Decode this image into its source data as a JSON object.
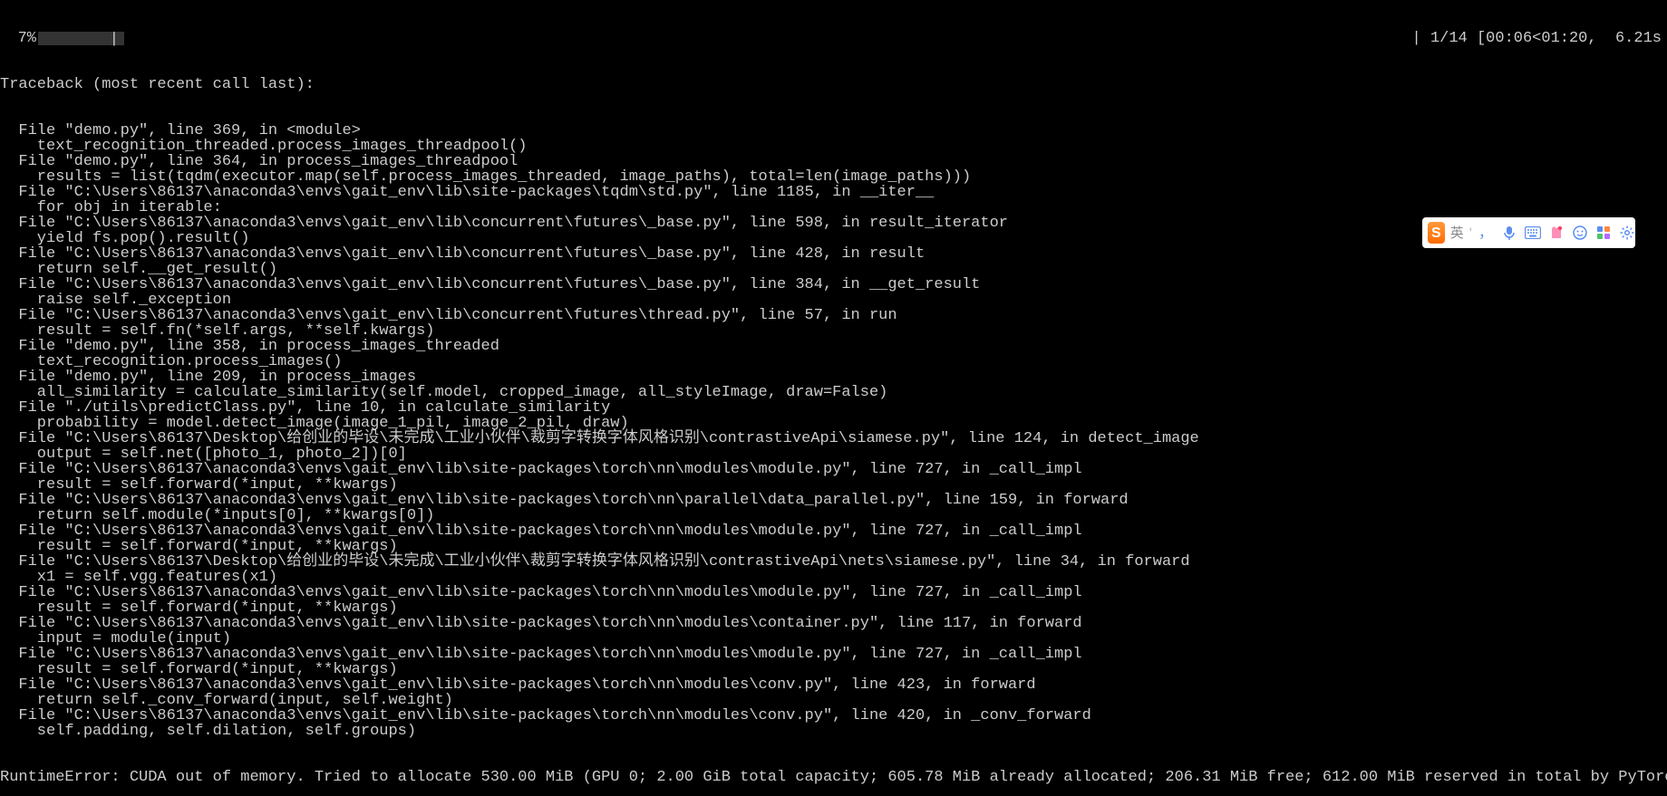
{
  "progress": {
    "percent_label": "7%",
    "fill_percent": 7,
    "stats": "| 1/14 [00:06<01:20,  6.21s"
  },
  "traceback": {
    "header": "Traceback (most recent call last):",
    "frames": [
      {
        "loc": "  File \"demo.py\", line 369, in <module>",
        "code": "    text_recognition_threaded.process_images_threadpool()"
      },
      {
        "loc": "  File \"demo.py\", line 364, in process_images_threadpool",
        "code": "    results = list(tqdm(executor.map(self.process_images_threaded, image_paths), total=len(image_paths)))"
      },
      {
        "loc": "  File \"C:\\Users\\86137\\anaconda3\\envs\\gait_env\\lib\\site-packages\\tqdm\\std.py\", line 1185, in __iter__",
        "code": "    for obj in iterable:"
      },
      {
        "loc": "  File \"C:\\Users\\86137\\anaconda3\\envs\\gait_env\\lib\\concurrent\\futures\\_base.py\", line 598, in result_iterator",
        "code": "    yield fs.pop().result()"
      },
      {
        "loc": "  File \"C:\\Users\\86137\\anaconda3\\envs\\gait_env\\lib\\concurrent\\futures\\_base.py\", line 428, in result",
        "code": "    return self.__get_result()"
      },
      {
        "loc": "  File \"C:\\Users\\86137\\anaconda3\\envs\\gait_env\\lib\\concurrent\\futures\\_base.py\", line 384, in __get_result",
        "code": "    raise self._exception"
      },
      {
        "loc": "  File \"C:\\Users\\86137\\anaconda3\\envs\\gait_env\\lib\\concurrent\\futures\\thread.py\", line 57, in run",
        "code": "    result = self.fn(*self.args, **self.kwargs)"
      },
      {
        "loc": "  File \"demo.py\", line 358, in process_images_threaded",
        "code": "    text_recognition.process_images()"
      },
      {
        "loc": "  File \"demo.py\", line 209, in process_images",
        "code": "    all_similarity = calculate_similarity(self.model, cropped_image, all_styleImage, draw=False)"
      },
      {
        "loc": "  File \"./utils\\predictClass.py\", line 10, in calculate_similarity",
        "code": "    probability = model.detect_image(image_1_pil, image_2_pil, draw)"
      },
      {
        "loc": "  File \"C:\\Users\\86137\\Desktop\\给创业的毕设\\未完成\\工业小伙伴\\裁剪字转换字体风格识别\\contrastiveApi\\siamese.py\", line 124, in detect_image",
        "code": "    output = self.net([photo_1, photo_2])[0]"
      },
      {
        "loc": "  File \"C:\\Users\\86137\\anaconda3\\envs\\gait_env\\lib\\site-packages\\torch\\nn\\modules\\module.py\", line 727, in _call_impl",
        "code": "    result = self.forward(*input, **kwargs)"
      },
      {
        "loc": "  File \"C:\\Users\\86137\\anaconda3\\envs\\gait_env\\lib\\site-packages\\torch\\nn\\parallel\\data_parallel.py\", line 159, in forward",
        "code": "    return self.module(*inputs[0], **kwargs[0])"
      },
      {
        "loc": "  File \"C:\\Users\\86137\\anaconda3\\envs\\gait_env\\lib\\site-packages\\torch\\nn\\modules\\module.py\", line 727, in _call_impl",
        "code": "    result = self.forward(*input, **kwargs)"
      },
      {
        "loc": "  File \"C:\\Users\\86137\\Desktop\\给创业的毕设\\未完成\\工业小伙伴\\裁剪字转换字体风格识别\\contrastiveApi\\nets\\siamese.py\", line 34, in forward",
        "code": "    x1 = self.vgg.features(x1)"
      },
      {
        "loc": "  File \"C:\\Users\\86137\\anaconda3\\envs\\gait_env\\lib\\site-packages\\torch\\nn\\modules\\module.py\", line 727, in _call_impl",
        "code": "    result = self.forward(*input, **kwargs)"
      },
      {
        "loc": "  File \"C:\\Users\\86137\\anaconda3\\envs\\gait_env\\lib\\site-packages\\torch\\nn\\modules\\container.py\", line 117, in forward",
        "code": "    input = module(input)"
      },
      {
        "loc": "  File \"C:\\Users\\86137\\anaconda3\\envs\\gait_env\\lib\\site-packages\\torch\\nn\\modules\\module.py\", line 727, in _call_impl",
        "code": "    result = self.forward(*input, **kwargs)"
      },
      {
        "loc": "  File \"C:\\Users\\86137\\anaconda3\\envs\\gait_env\\lib\\site-packages\\torch\\nn\\modules\\conv.py\", line 423, in forward",
        "code": "    return self._conv_forward(input, self.weight)"
      },
      {
        "loc": "  File \"C:\\Users\\86137\\anaconda3\\envs\\gait_env\\lib\\site-packages\\torch\\nn\\modules\\conv.py\", line 420, in _conv_forward",
        "code": "    self.padding, self.dilation, self.groups)"
      }
    ],
    "error": "RuntimeError: CUDA out of memory. Tried to allocate 530.00 MiB (GPU 0; 2.00 GiB total capacity; 605.78 MiB already allocated; 206.31 MiB free; 612.00 MiB reserved in total by PyTorch)"
  },
  "ime": {
    "logo_letter": "S",
    "language_label": "英",
    "separator": "'",
    "icons": [
      "comma-icon",
      "mic-icon",
      "keyboard-icon",
      "skin-icon",
      "smiley-icon",
      "apps-icon",
      "settings-icon"
    ]
  }
}
